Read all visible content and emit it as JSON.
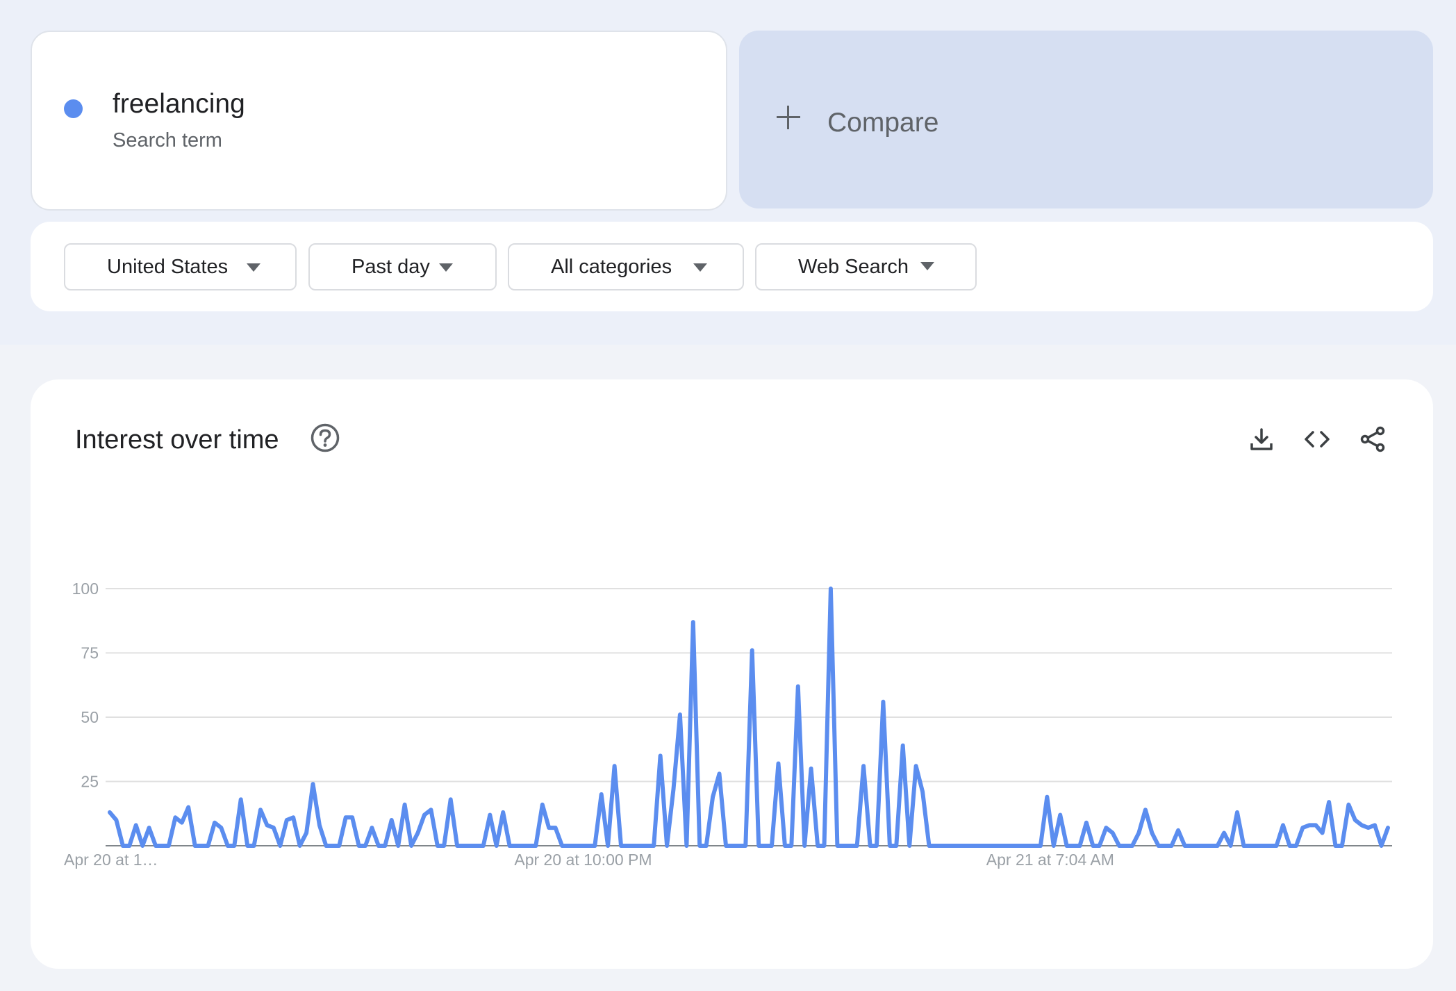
{
  "search_term": {
    "name": "freelancing",
    "type_label": "Search term",
    "dot_color": "#5b8def"
  },
  "compare": {
    "label": "Compare",
    "icon": "plus-icon"
  },
  "filters": [
    {
      "label": "United States",
      "icon": "caret-down-icon"
    },
    {
      "label": "Past day",
      "icon": "caret-down-icon"
    },
    {
      "label": "All categories",
      "icon": "caret-down-icon"
    },
    {
      "label": "Web Search",
      "icon": "caret-down-icon"
    }
  ],
  "interest_over_time": {
    "title": "Interest over time",
    "icons": [
      "help-circle-icon",
      "download-icon",
      "embed-code-icon",
      "share-icon"
    ]
  },
  "chart_data": {
    "type": "line",
    "ylim": [
      0,
      100
    ],
    "yticks": [
      25,
      50,
      75,
      100
    ],
    "grid": true,
    "line_color": "#5b8def",
    "x_tick_labels": [
      {
        "label": "Apr 20 at 1…",
        "index": 0
      },
      {
        "label": "Apr 20 at 10:00 PM",
        "index": 72
      },
      {
        "label": "Apr 21 at 7:04 AM",
        "index": 144
      }
    ],
    "series": [
      {
        "values": [
          13,
          10,
          0,
          0,
          8,
          0,
          7,
          0,
          0,
          0,
          11,
          9,
          15,
          0,
          0,
          0,
          9,
          7,
          0,
          0,
          18,
          0,
          0,
          14,
          8,
          7,
          0,
          10,
          11,
          0,
          5,
          24,
          8,
          0,
          0,
          0,
          11,
          11,
          0,
          0,
          7,
          0,
          0,
          10,
          0,
          16,
          0,
          5,
          12,
          14,
          0,
          0,
          18,
          0,
          0,
          0,
          0,
          0,
          12,
          0,
          13,
          0,
          0,
          0,
          0,
          0,
          16,
          7,
          7,
          0,
          0,
          0,
          0,
          0,
          0,
          20,
          0,
          31,
          0,
          0,
          0,
          0,
          0,
          0,
          35,
          0,
          22,
          51,
          0,
          87,
          0,
          0,
          19,
          28,
          0,
          0,
          0,
          0,
          76,
          0,
          0,
          0,
          32,
          0,
          0,
          62,
          0,
          30,
          0,
          0,
          100,
          0,
          0,
          0,
          0,
          31,
          0,
          0,
          56,
          0,
          0,
          39,
          0,
          31,
          21,
          0,
          0,
          0,
          0,
          0,
          0,
          0,
          0,
          0,
          0,
          0,
          0,
          0,
          0,
          0,
          0,
          0,
          0,
          19,
          0,
          12,
          0,
          0,
          0,
          9,
          0,
          0,
          7,
          5,
          0,
          0,
          0,
          5,
          14,
          5,
          0,
          0,
          0,
          6,
          0,
          0,
          0,
          0,
          0,
          0,
          5,
          0,
          13,
          0,
          0,
          0,
          0,
          0,
          0,
          8,
          0,
          0,
          7,
          8,
          8,
          5,
          17,
          0,
          0,
          16,
          10,
          8,
          7,
          8,
          0,
          7
        ]
      }
    ]
  }
}
